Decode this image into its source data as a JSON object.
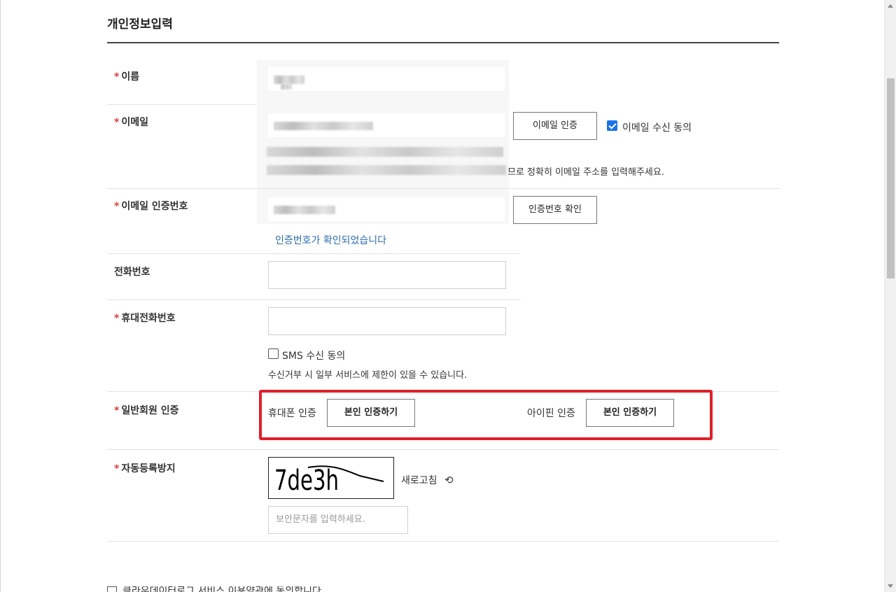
{
  "section": {
    "title": "개인정보입력"
  },
  "fields": {
    "name": {
      "label": "이름"
    },
    "email": {
      "label": "이메일",
      "verify_button": "이메일 인증",
      "consent_label": "이메일 수신 동의",
      "notice_tail": "므로 정확히 이메일 주소를 입력해주세요."
    },
    "email_code": {
      "label": "이메일 인증번호",
      "confirm_button": "인증번호 확인",
      "status": "인증번호가 확인되었습니다"
    },
    "phone": {
      "label": "전화번호",
      "value": ""
    },
    "mobile": {
      "label": "휴대전화번호",
      "value": "",
      "sms_label": "SMS 수신 동의",
      "sms_notice": "수신거부 시 일부 서비스에 제한이 있을 수 있습니다."
    },
    "member_auth": {
      "label": "일반회원 인증",
      "phone_label": "휴대폰 인증",
      "phone_button": "본인 인증하기",
      "ipin_label": "아이핀 인증",
      "ipin_button": "본인 인증하기"
    },
    "captcha": {
      "label": "자동등록방지",
      "image_text": "7de3h",
      "refresh_label": "새로고침",
      "input_placeholder": "보안문자를 입력하세요."
    }
  },
  "required_mark": "*",
  "colors": {
    "required": "#e23a3a",
    "status_blue": "#2b6cb0",
    "highlight_border": "#e0202b",
    "checkbox_on": "#1a73e8"
  },
  "cut_text": "클라우데이터로그 서비스 이용약관에 동의합니다"
}
